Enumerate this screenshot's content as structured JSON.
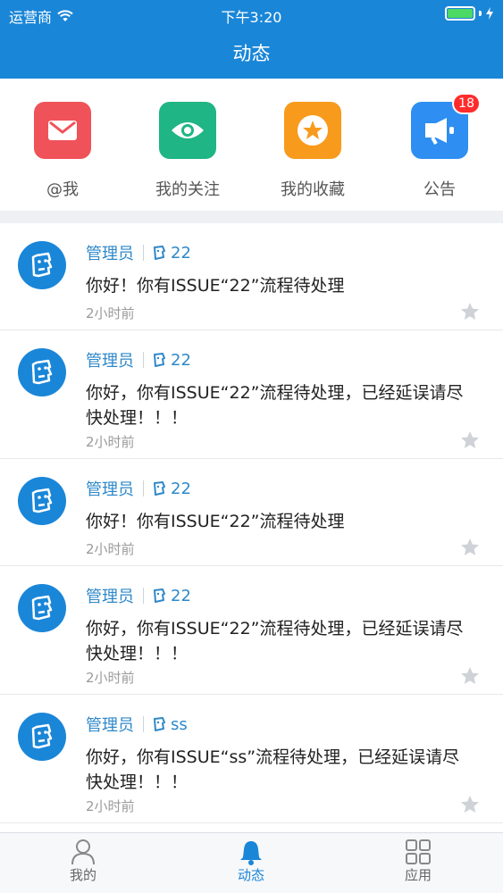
{
  "status_bar": {
    "carrier": "运营商",
    "time": "下午3:20"
  },
  "header": {
    "title": "动态"
  },
  "shortcuts": [
    {
      "label": "@我",
      "icon": "mail-icon",
      "color": "#f0525a"
    },
    {
      "label": "我的关注",
      "icon": "eye-icon",
      "color": "#1fb584"
    },
    {
      "label": "我的收藏",
      "icon": "star-icon",
      "color": "#f89a1c"
    },
    {
      "label": "公告",
      "icon": "megaphone-icon",
      "color": "#2e8ef1",
      "badge": "18"
    }
  ],
  "feed": [
    {
      "author": "管理员",
      "tag": "22",
      "message": "你好！你有ISSUE“22”流程待处理",
      "time": "2小时前"
    },
    {
      "author": "管理员",
      "tag": "22",
      "message": "你好，你有ISSUE“22”流程待处理，已经延误请尽快处理！！！",
      "time": "2小时前"
    },
    {
      "author": "管理员",
      "tag": "22",
      "message": "你好！你有ISSUE“22”流程待处理",
      "time": "2小时前"
    },
    {
      "author": "管理员",
      "tag": "22",
      "message": "你好，你有ISSUE“22”流程待处理，已经延误请尽快处理！！！",
      "time": "2小时前"
    },
    {
      "author": "管理员",
      "tag": "ss",
      "message": "你好，你有ISSUE“ss”流程待处理，已经延误请尽快处理！！！",
      "time": "2小时前"
    }
  ],
  "tabbar": {
    "tabs": [
      {
        "label": "我的"
      },
      {
        "label": "动态"
      },
      {
        "label": "应用"
      }
    ],
    "active_color": "#1a86d8"
  }
}
